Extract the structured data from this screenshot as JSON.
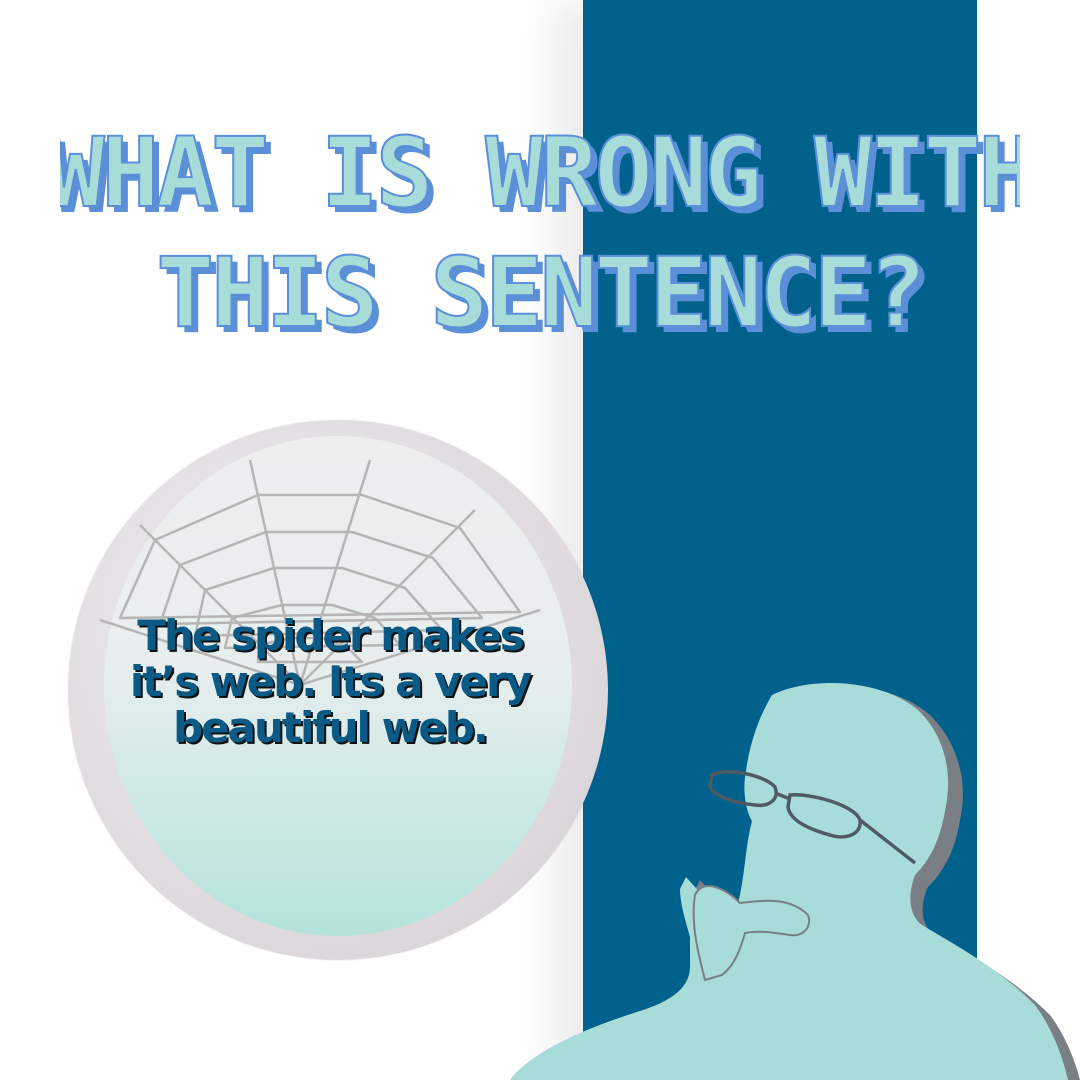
{
  "headline": {
    "line1": "WHAT IS WRONG WITH",
    "line2": "THIS SENTENCE?"
  },
  "sentence": {
    "line1": "The spider makes",
    "line2": "it’s web. Its a very",
    "line3": "beautiful web."
  },
  "icons": {
    "spider_web": "spider-web-icon",
    "thinking_person": "thinking-person-silhouette"
  },
  "colors": {
    "background": "#ffffff",
    "panel_blue": "#00628c",
    "headline_fill": "#a8dcd9",
    "headline_shadow": "#5b8fd8",
    "sentence_fill": "#0b5a86",
    "sentence_shadow": "#111111",
    "person_fill": "#a8dcd9",
    "person_shadow": "#7a7f86",
    "bubble_rim": "#dcd8dc",
    "bubble_inner_bottom": "#b4e2dc"
  }
}
